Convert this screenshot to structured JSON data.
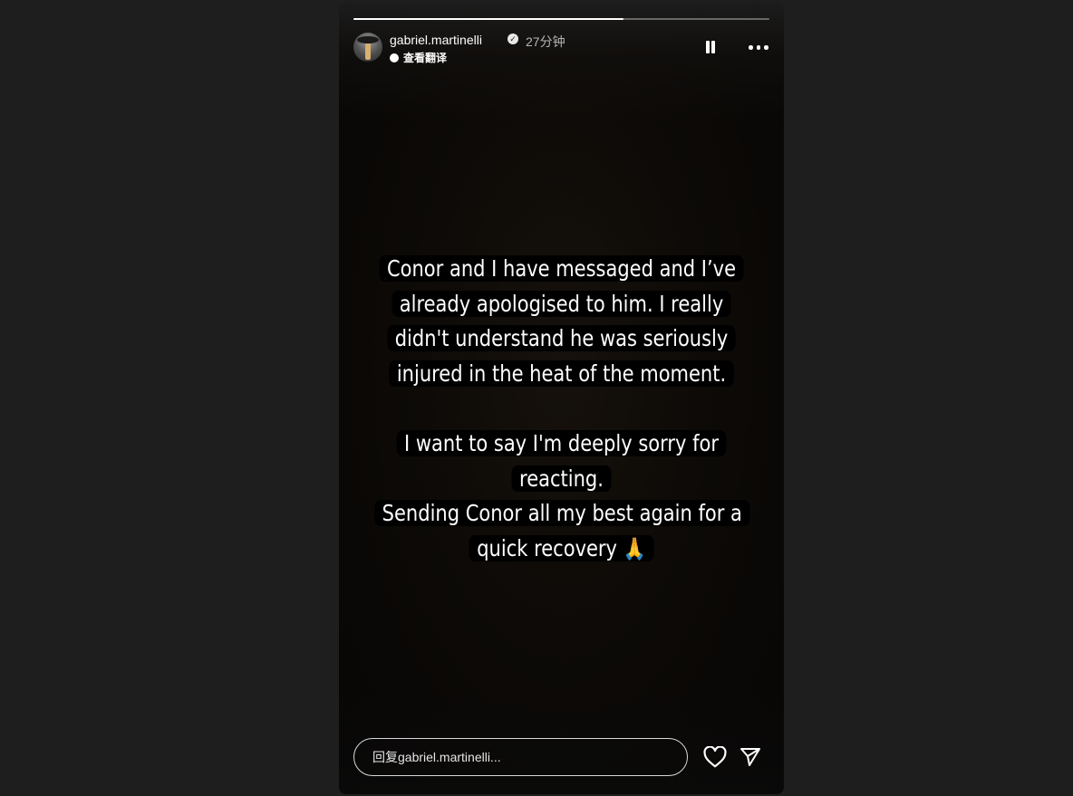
{
  "story": {
    "progress": 0.65,
    "header": {
      "username": "gabriel.martinelli",
      "verified": true,
      "time_ago": "27分钟",
      "translate_label": "查看翻译"
    },
    "caption": {
      "paragraph_1": "Conor and I have messaged and I’ve already apologised to him. I really didn't understand he was seriously injured in the heat of the moment.",
      "paragraph_2": "I want to say I'm deeply sorry for reacting.",
      "paragraph_3": "Sending Conor all my best again for a quick recovery",
      "emoji": "🙏"
    },
    "reply": {
      "placeholder": "回复gabriel.martinelli..."
    },
    "icons": {
      "pause": "pause-icon",
      "more": "more-icon",
      "like": "heart-icon",
      "send": "send-icon",
      "verified": "verified-badge-icon",
      "translate": "translate-icon"
    }
  },
  "colors": {
    "background": "#1e1e1e",
    "story_background": "#0d0a07",
    "text": "#ffffff",
    "caption_highlight": "#000000"
  }
}
